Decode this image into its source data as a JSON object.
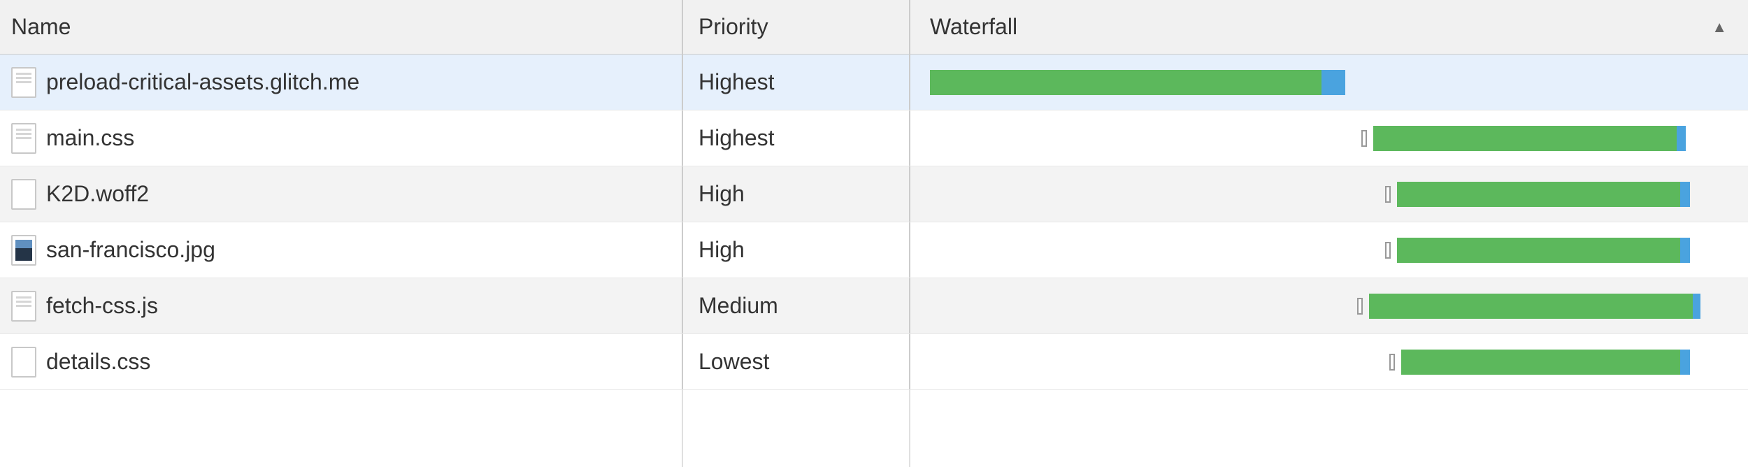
{
  "columns": {
    "name": "Name",
    "priority": "Priority",
    "waterfall": "Waterfall"
  },
  "sort": {
    "column": "waterfall",
    "direction": "asc",
    "glyph": "▲"
  },
  "colors": {
    "bar_fill": "#5cb85c",
    "bar_tail": "#4aa3df"
  },
  "rows": [
    {
      "name": "preload-critical-assets.glitch.me",
      "priority": "Highest",
      "icon": "doc",
      "selected": true,
      "waterfall": {
        "queue_start_pct": 0,
        "bar_start_pct": 0,
        "bar_width_pct": 49,
        "tail_width_pct": 3
      }
    },
    {
      "name": "main.css",
      "priority": "Highest",
      "icon": "doc",
      "waterfall": {
        "queue_start_pct": 54,
        "bar_start_pct": 55.5,
        "bar_width_pct": 38,
        "tail_width_pct": 1.2
      }
    },
    {
      "name": "K2D.woff2",
      "priority": "High",
      "icon": "blank",
      "waterfall": {
        "queue_start_pct": 57,
        "bar_start_pct": 58.5,
        "bar_width_pct": 35.5,
        "tail_width_pct": 1.2
      }
    },
    {
      "name": "san-francisco.jpg",
      "priority": "High",
      "icon": "image",
      "waterfall": {
        "queue_start_pct": 57,
        "bar_start_pct": 58.5,
        "bar_width_pct": 35.5,
        "tail_width_pct": 1.2
      }
    },
    {
      "name": "fetch-css.js",
      "priority": "Medium",
      "icon": "doc",
      "waterfall": {
        "queue_start_pct": 53.5,
        "bar_start_pct": 55,
        "bar_width_pct": 40.5,
        "tail_width_pct": 1
      }
    },
    {
      "name": "details.css",
      "priority": "Lowest",
      "icon": "blank",
      "waterfall": {
        "queue_start_pct": 57.5,
        "bar_start_pct": 59,
        "bar_width_pct": 35,
        "tail_width_pct": 1.2
      }
    }
  ]
}
